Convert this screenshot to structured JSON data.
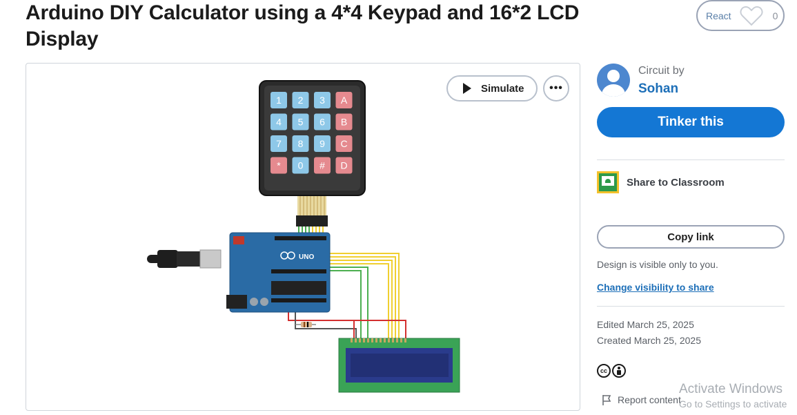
{
  "project": {
    "title": "Arduino DIY Calculator using a 4*4 Keypad and 16*2 LCD Display"
  },
  "react": {
    "label": "React",
    "count": "0"
  },
  "canvas": {
    "simulate_label": "Simulate",
    "more_label": "•••",
    "keypad_keys": [
      "1",
      "2",
      "3",
      "A",
      "4",
      "5",
      "6",
      "B",
      "7",
      "8",
      "9",
      "C",
      "*",
      "0",
      "#",
      "D"
    ],
    "arduino_label": "UNO"
  },
  "sidebar": {
    "circuit_by_label": "Circuit by",
    "author": "Sohan",
    "tinker_label": "Tinker this",
    "share_classroom_label": "Share to Classroom",
    "copy_link_label": "Copy link",
    "visibility_note": "Design is visible only to you.",
    "visibility_link": "Change visibility to share",
    "edited": "Edited March 25, 2025",
    "created": "Created March 25, 2025",
    "license_icons": [
      "cc",
      "by"
    ],
    "report_label": "Report content"
  },
  "watermark": {
    "line1": "Activate Windows",
    "line2": "Go to Settings to activate"
  },
  "colors": {
    "accent": "#1477d4",
    "link": "#1d6fb8",
    "keypad_blue": "#8ec8e8",
    "keypad_red": "#e58a8f",
    "arduino_blue": "#2a6ba5",
    "lcd_green": "#3aa356",
    "wire_yellow": "#f0cf30",
    "wire_green": "#4caf50",
    "wire_red": "#d32f2f"
  }
}
